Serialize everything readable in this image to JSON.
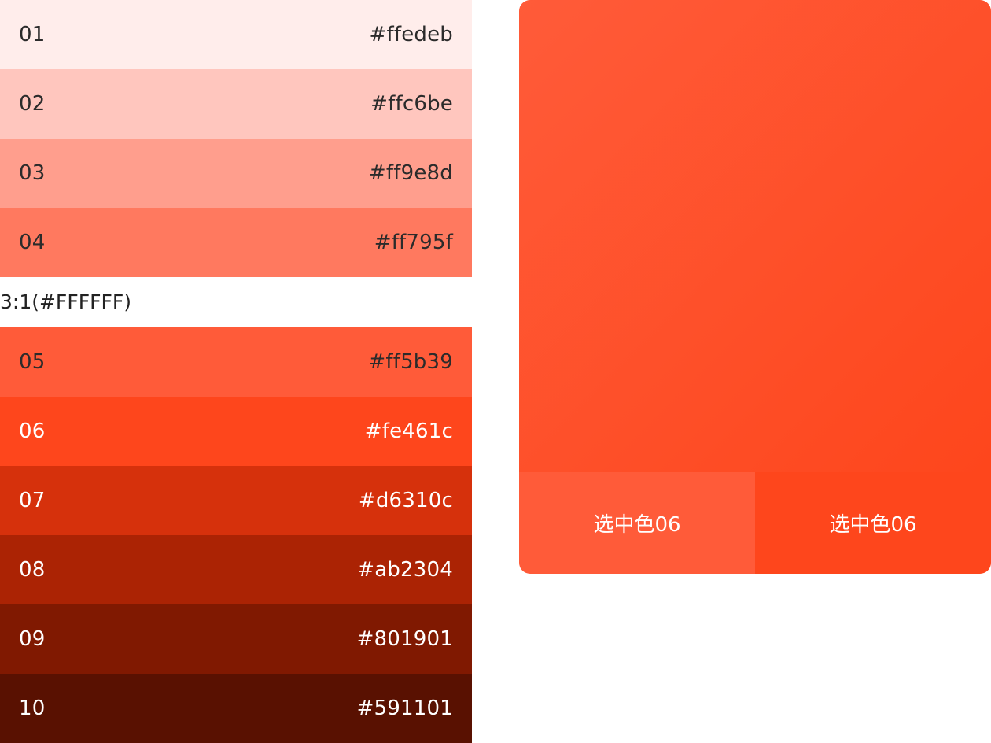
{
  "palette_top": [
    {
      "step": "01",
      "hex": "#ffedeb",
      "bg": "#ffedeb",
      "text": "dark"
    },
    {
      "step": "02",
      "hex": "#ffc6be",
      "bg": "#ffc6be",
      "text": "dark"
    },
    {
      "step": "03",
      "hex": "#ff9e8d",
      "bg": "#ff9e8d",
      "text": "dark"
    },
    {
      "step": "04",
      "hex": "#ff795f",
      "bg": "#ff795f",
      "text": "dark"
    }
  ],
  "contrast_label": "3:1(#FFFFFF)",
  "palette_bottom": [
    {
      "step": "05",
      "hex": "#ff5b39",
      "bg": "#ff5b39",
      "text": "dark"
    },
    {
      "step": "06",
      "hex": "#fe461c",
      "bg": "#fe461c",
      "text": "light"
    },
    {
      "step": "07",
      "hex": "#d6310c",
      "bg": "#d6310c",
      "text": "light"
    },
    {
      "step": "08",
      "hex": "#ab2304",
      "bg": "#ab2304",
      "text": "light"
    },
    {
      "step": "09",
      "hex": "#801901",
      "bg": "#801901",
      "text": "light"
    },
    {
      "step": "10",
      "hex": "#591101",
      "bg": "#591101",
      "text": "light"
    }
  ],
  "preview": {
    "gradient_from": "#ff5b39",
    "gradient_to": "#fe461c",
    "left_label": "选中色06",
    "left_bg": "#ff5b39",
    "right_label": "选中色06",
    "right_bg": "#fe461c"
  }
}
